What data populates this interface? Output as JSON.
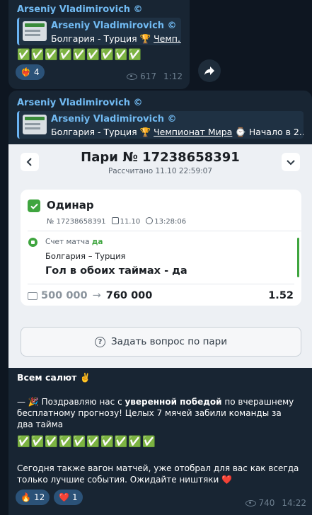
{
  "post1": {
    "sender": "Arseniy Vladimirovich ©",
    "forward": {
      "name": "Arseniy Vladimirovich ©",
      "text_before": "Болгария - Турция 🏆 ",
      "text_link": "Чемп..."
    },
    "checks": "✅✅✅✅✅✅✅✅✅",
    "reaction": {
      "emoji": "❤️‍🔥",
      "count": "4"
    },
    "views": "617",
    "time": "1:12"
  },
  "post2": {
    "sender": "Arseniy Vladimirovich ©",
    "forward": {
      "name": "Arseniy Vladimirovich ©",
      "text_before": "Болгария - Турция 🏆 ",
      "text_link": "Чемпионат Мира",
      "text_after": " ⌚ Начало в 2..."
    },
    "receipt": {
      "title": "Пари № 17238658391",
      "calculated": "Рассчитано 11.10 22:59:07",
      "bet_type": "Одинар",
      "bet_number": "№ 17238658391",
      "date": "11.10",
      "time": "13:28:06",
      "market_label": "Счет матча",
      "market_value": "да",
      "match": "Болгария – Турция",
      "outcome": "Гол в обоих таймах - да",
      "stake": "500 000",
      "payout": "760 000",
      "odds": "1.52",
      "ask_button": "Задать вопрос по пари"
    },
    "message": {
      "greeting": "Всем салют ✌️",
      "p1_a": "— 🎉 Поздравляю нас с ",
      "p1_bold": "уверенной победой",
      "p1_b": " по вчерашнему бесплатному прогнозу! Целых 7 мячей забили команды за два тайма",
      "checks": "✅✅✅✅✅✅✅✅✅✅",
      "p2": "Сегодня также вагон матчей, уже отобрал для вас как всегда только лучшие события. Ожидайте ништяки ❤️"
    },
    "reactions": [
      {
        "emoji": "🔥",
        "count": "12"
      },
      {
        "emoji": "❤️",
        "count": "1"
      }
    ],
    "views": "740",
    "time": "14:22"
  }
}
